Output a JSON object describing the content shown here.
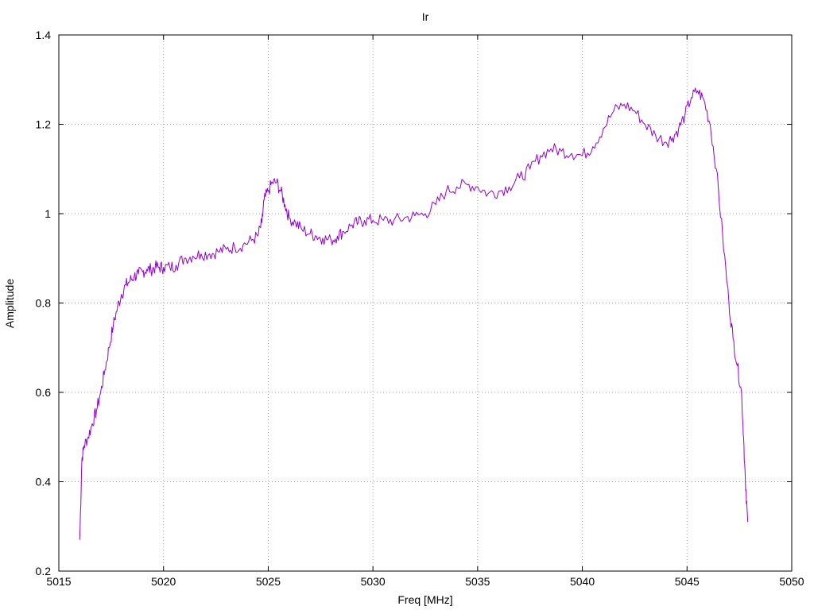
{
  "chart_data": {
    "type": "line",
    "title": "Ir",
    "xlabel": "Freq [MHz]",
    "ylabel": "Amplitude",
    "xlim": [
      5015,
      5050
    ],
    "ylim": [
      0.2,
      1.4
    ],
    "xticks": [
      5015,
      5020,
      5025,
      5030,
      5035,
      5040,
      5045,
      5050
    ],
    "yticks": [
      0.2,
      0.4,
      0.6,
      0.8,
      1.0,
      1.2,
      1.4
    ],
    "xtick_labels": [
      "5015",
      "5020",
      "5025",
      "5030",
      "5035",
      "5040",
      "5045",
      "5050"
    ],
    "ytick_labels": [
      "0.2",
      "0.4",
      "0.6",
      "0.8",
      "1",
      "1.2",
      "1.4"
    ],
    "grid": true,
    "colors": {
      "line": "#9400d3"
    },
    "series": [
      {
        "x": [
          5016.0,
          5016.1,
          5016.2,
          5016.4,
          5016.6,
          5016.8,
          5017.0,
          5017.2,
          5017.4,
          5017.6,
          5017.8,
          5018.0,
          5018.2,
          5018.4,
          5018.6,
          5018.8,
          5019.0,
          5019.2,
          5019.4,
          5019.6,
          5019.8,
          5020.0,
          5020.3,
          5020.6,
          5021.0,
          5021.4,
          5021.8,
          5022.2,
          5022.6,
          5023.0,
          5023.4,
          5023.8,
          5024.2,
          5024.5,
          5024.7,
          5024.8,
          5025.0,
          5025.2,
          5025.4,
          5025.6,
          5025.8,
          5026.0,
          5026.3,
          5026.6,
          5027.0,
          5027.3,
          5027.6,
          5028.0,
          5028.3,
          5028.6,
          5029.0,
          5029.3,
          5029.6,
          5030.0,
          5030.5,
          5031.0,
          5031.5,
          5032.0,
          5032.5,
          5033.0,
          5033.5,
          5034.0,
          5034.5,
          5035.0,
          5035.5,
          5036.0,
          5036.5,
          5037.0,
          5037.5,
          5038.0,
          5038.5,
          5039.0,
          5039.5,
          5040.0,
          5040.5,
          5041.0,
          5041.5,
          5042.0,
          5042.5,
          5043.0,
          5043.5,
          5044.0,
          5044.3,
          5044.6,
          5044.9,
          5045.2,
          5045.5,
          5045.8,
          5046.1,
          5046.4,
          5046.7,
          5047.0,
          5047.2,
          5047.4,
          5047.6,
          5047.7,
          5047.8,
          5047.9
        ],
        "y": [
          0.27,
          0.45,
          0.48,
          0.5,
          0.53,
          0.56,
          0.6,
          0.65,
          0.7,
          0.75,
          0.79,
          0.82,
          0.84,
          0.85,
          0.86,
          0.865,
          0.87,
          0.875,
          0.875,
          0.88,
          0.88,
          0.88,
          0.88,
          0.885,
          0.9,
          0.905,
          0.91,
          0.91,
          0.915,
          0.92,
          0.925,
          0.93,
          0.94,
          0.95,
          0.98,
          1.03,
          1.05,
          1.07,
          1.07,
          1.05,
          1.02,
          0.99,
          0.98,
          0.965,
          0.955,
          0.95,
          0.945,
          0.94,
          0.95,
          0.96,
          0.975,
          0.98,
          0.985,
          0.985,
          0.985,
          0.985,
          0.99,
          0.995,
          1.0,
          1.02,
          1.05,
          1.06,
          1.065,
          1.06,
          1.045,
          1.05,
          1.06,
          1.08,
          1.1,
          1.13,
          1.145,
          1.14,
          1.135,
          1.13,
          1.15,
          1.19,
          1.23,
          1.245,
          1.23,
          1.2,
          1.175,
          1.16,
          1.17,
          1.19,
          1.22,
          1.26,
          1.275,
          1.255,
          1.2,
          1.1,
          0.95,
          0.8,
          0.72,
          0.66,
          0.6,
          0.5,
          0.38,
          0.31
        ]
      }
    ]
  }
}
